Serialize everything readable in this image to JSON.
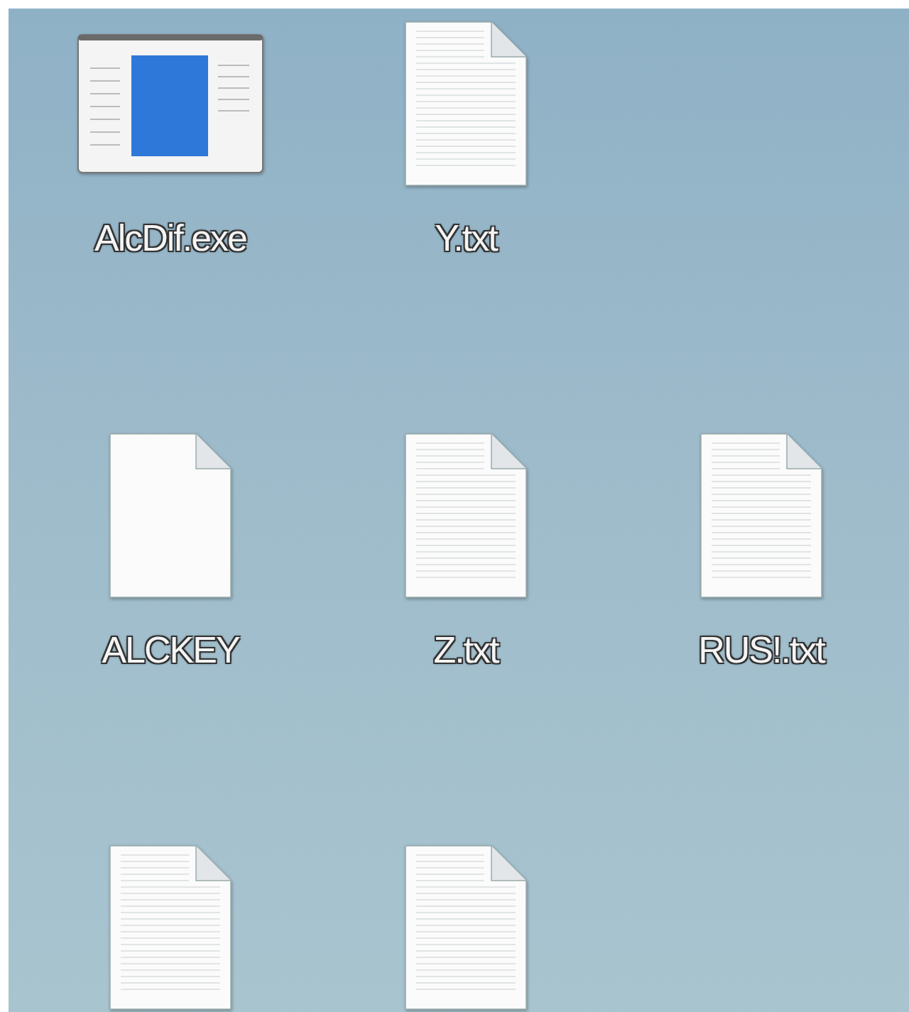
{
  "desktop_icons": [
    {
      "kind": "exe",
      "label": "AlcDif.exe"
    },
    {
      "kind": "text",
      "label": "Y.txt"
    },
    {
      "kind": "blank",
      "label": "ALCKEY"
    },
    {
      "kind": "text",
      "label": "Z.txt"
    },
    {
      "kind": "text",
      "label": "RUS!.txt"
    },
    {
      "kind": "text"
    },
    {
      "kind": "text"
    }
  ]
}
